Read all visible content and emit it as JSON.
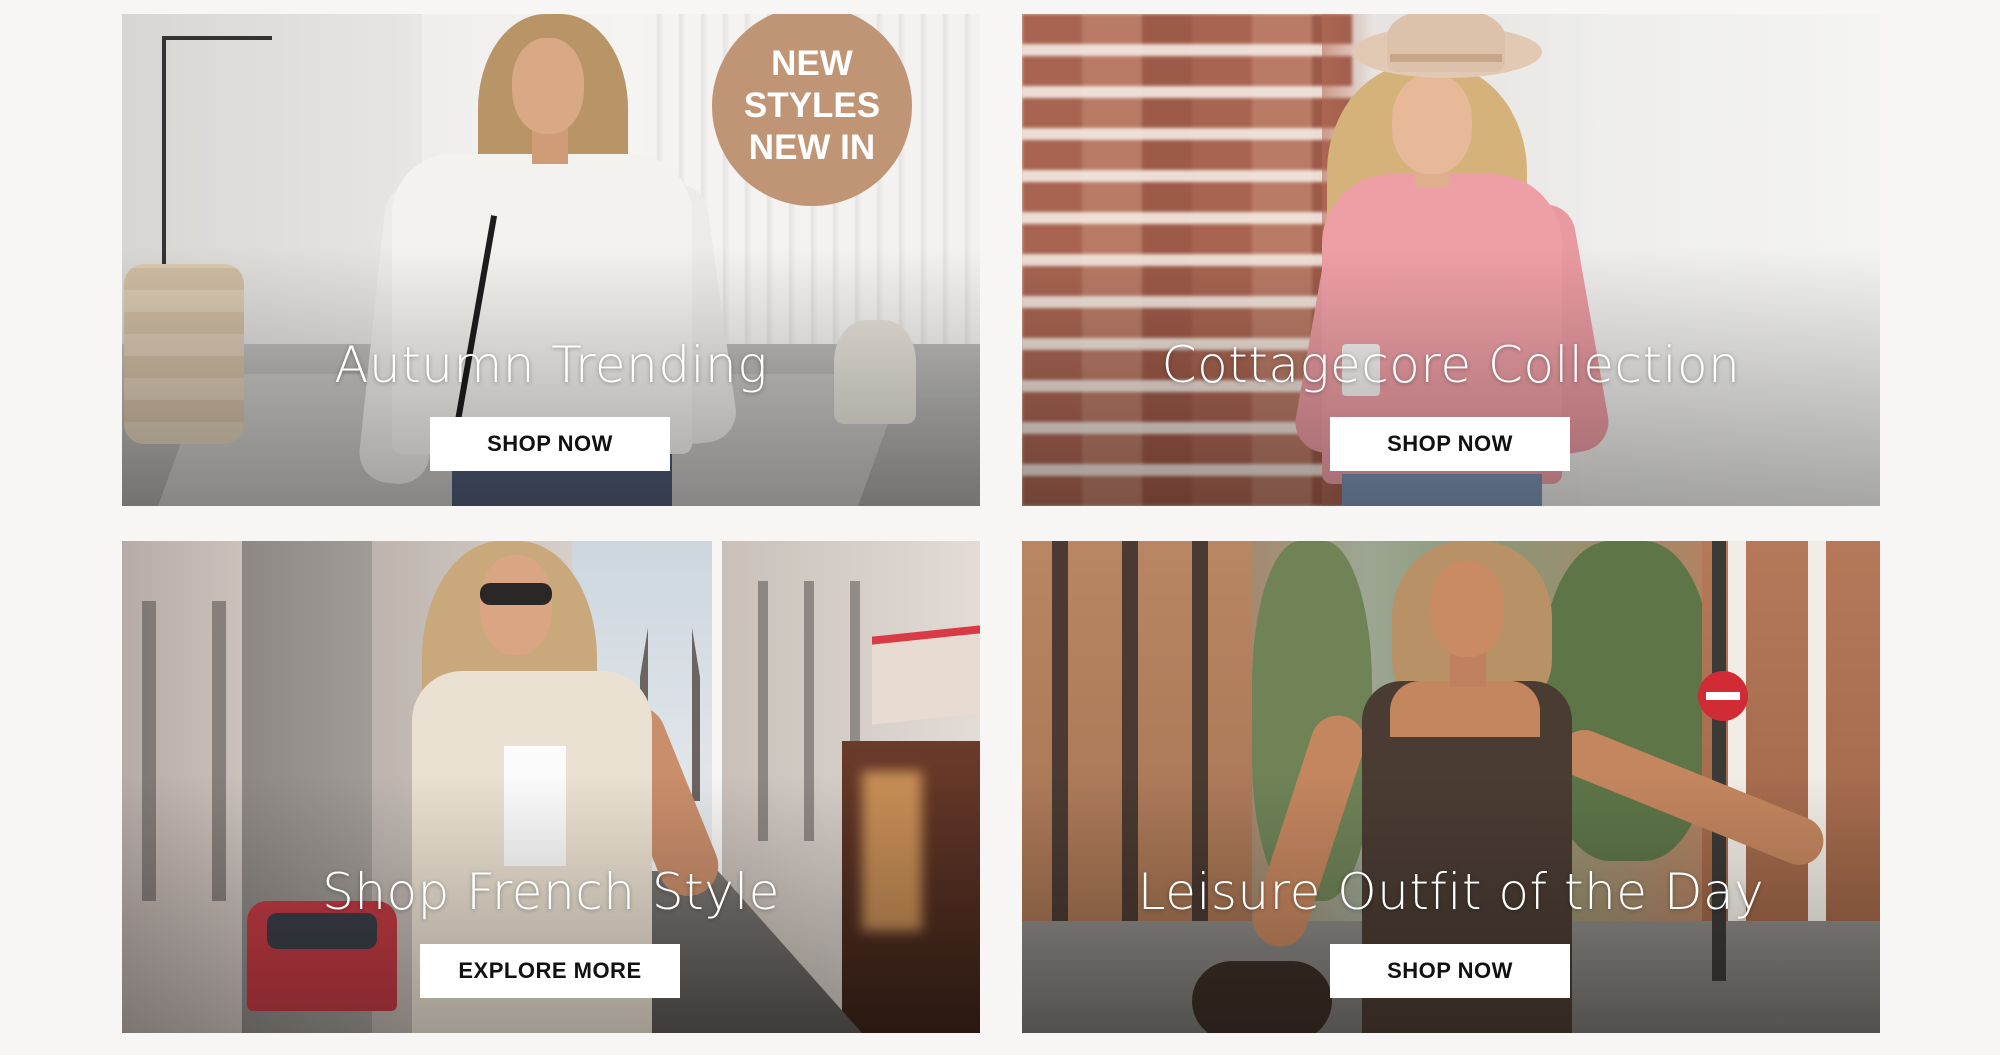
{
  "banners": [
    {
      "title": "Autumn Trending",
      "button_label": "SHOP NOW",
      "badge": {
        "line1": "NEW",
        "line2": "STYLES",
        "line3": "NEW IN",
        "color": "#c09575"
      }
    },
    {
      "title": "Cottagecore Collection",
      "button_label": "SHOP NOW"
    },
    {
      "title": "Shop French Style",
      "button_label": "EXPLORE MORE"
    },
    {
      "title": "Leisure Outfit of the Day",
      "button_label": "SHOP NOW"
    }
  ],
  "colors": {
    "page_background": "#f7f6f4",
    "button_background": "#ffffff",
    "button_text": "#111111",
    "title_text": "#ffffff"
  }
}
